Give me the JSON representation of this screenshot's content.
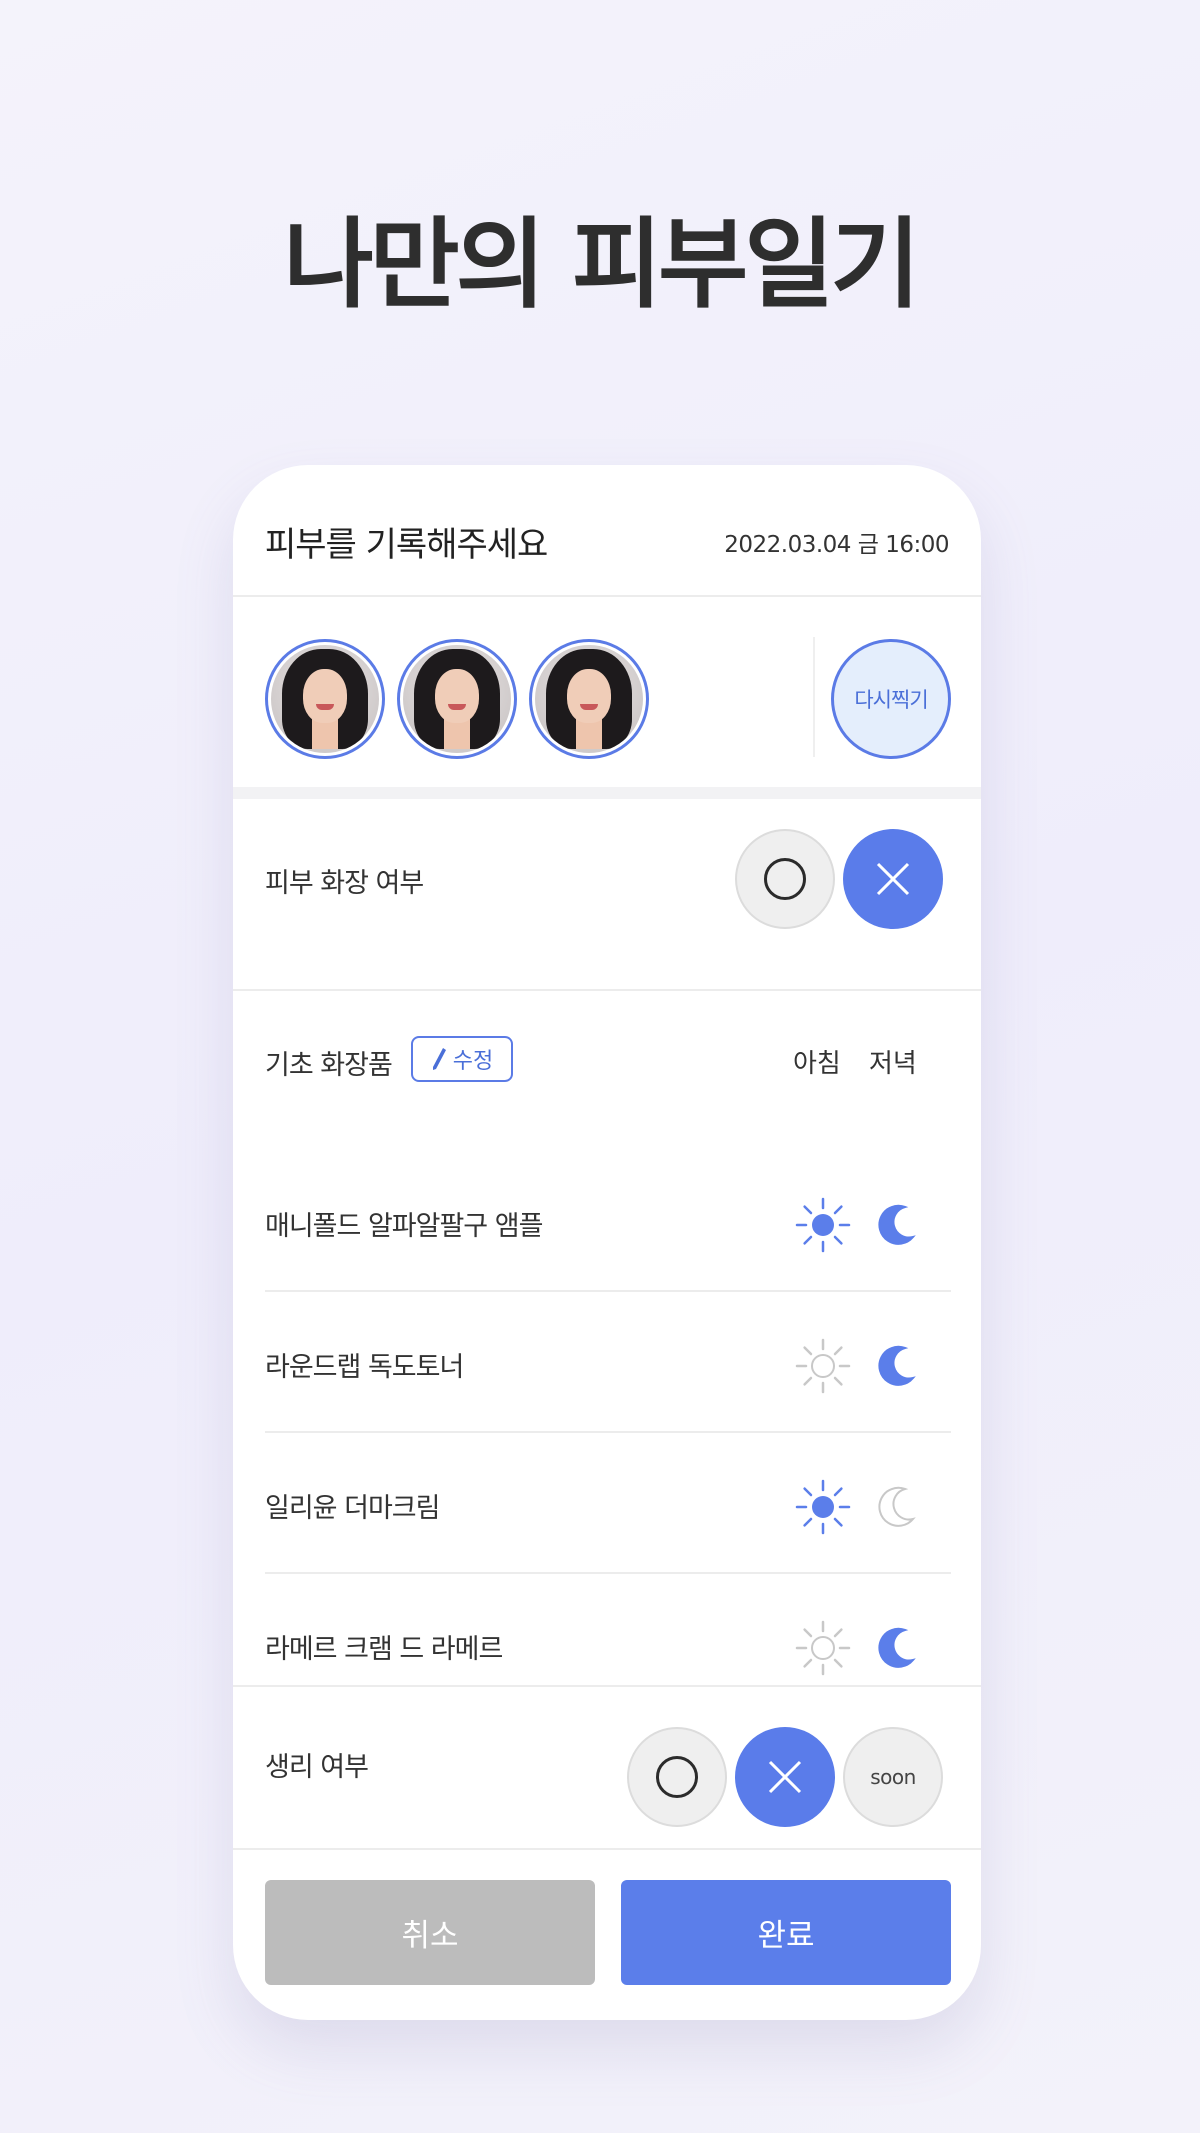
{
  "headline": "나만의 피부일기",
  "header": {
    "title": "피부를 기록해주세요",
    "datetime": "2022.03.04 금 16:00"
  },
  "photos": {
    "retake_label": "다시찍기"
  },
  "makeup": {
    "label": "피부 화장 여부",
    "selected": "X"
  },
  "skincare": {
    "label": "기초 화장품",
    "edit_label": "수정",
    "col_morning": "아침",
    "col_evening": "저녁",
    "items": [
      {
        "name": "매니폴드 알파알팔구 앰플",
        "morning": true,
        "evening": true
      },
      {
        "name": "라운드랩 독도토너",
        "morning": false,
        "evening": true
      },
      {
        "name": "일리윤 더마크림",
        "morning": true,
        "evening": false
      },
      {
        "name": "라메르 크램 드  라메르",
        "morning": false,
        "evening": true
      }
    ]
  },
  "period": {
    "label": "생리 여부",
    "soon_label": "soon",
    "selected": "X"
  },
  "actions": {
    "cancel_label": "취소",
    "done_label": "완료"
  },
  "colors": {
    "accent": "#5B7EEA",
    "inactive": "#BCBCBC",
    "icon_off": "#C8C8C8"
  },
  "icons": {
    "sun": "sun-icon",
    "moon": "moon-icon",
    "pencil": "pencil-icon"
  }
}
